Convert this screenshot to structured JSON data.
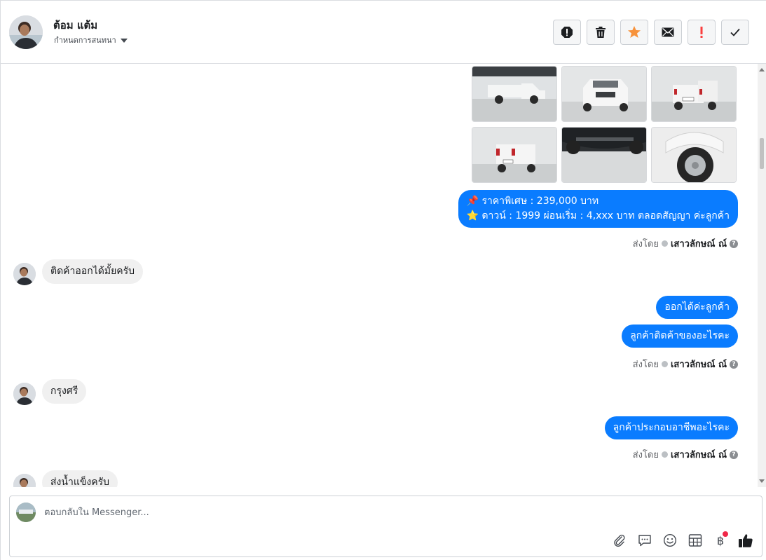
{
  "header": {
    "contact_name": "ต้อม แต้ม",
    "assign_label": "กำหนดการสนทนา",
    "actions": [
      {
        "name": "report-icon",
        "color": "#1c1e21"
      },
      {
        "name": "trash-icon",
        "color": "#1c1e21"
      },
      {
        "name": "star-icon",
        "color": "#f7923b"
      },
      {
        "name": "mail-icon",
        "color": "#1c1e21"
      },
      {
        "name": "exclamation-icon",
        "color": "#fa3e3e"
      },
      {
        "name": "check-icon",
        "color": "#1c1e21"
      }
    ]
  },
  "thread": {
    "photos": [
      {
        "name": "truck-side-photo"
      },
      {
        "name": "truck-front-photo"
      },
      {
        "name": "truck-rear-photo"
      },
      {
        "name": "truck-rear-left-photo"
      },
      {
        "name": "truck-underbody-photo"
      },
      {
        "name": "truck-wheel-photo"
      }
    ],
    "price_message": {
      "line1_icon": "📌",
      "line1": "ราคาพิเศษ : 239,000 บาท",
      "line2_icon": "⭐",
      "line2": "ดาวน์ : 1999 ผ่อนเริ่ม : 4,xxx บาท ตลอดสัญญา ค่ะลูกค้า"
    },
    "sent_by_label": "ส่งโดย",
    "sender_name": "เสาวลักษณ์ ณ์",
    "help_glyph": "?",
    "incoming_1": "ติดค้าออกได้มั้ยครับ",
    "outgoing_1": "ออกได้ค่ะลูกค้า",
    "outgoing_2": "ลูกค้าติดค้าของอะไรคะ",
    "incoming_2": "กรุงศรี",
    "outgoing_3": "ลูกค้าประกอบอาชีพอะไรคะ",
    "incoming_3": "ส่งน้ำแข็งครับ"
  },
  "composer": {
    "placeholder": "ตอบกลับใน Messenger...",
    "value": "",
    "tools": [
      "paperclip-icon",
      "saved-reply-icon",
      "emoji-icon",
      "table-icon",
      "baht-icon",
      "thumbs-up-icon"
    ],
    "baht_glyph": "฿",
    "accent_color": "#0a7cff"
  }
}
